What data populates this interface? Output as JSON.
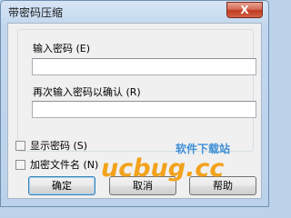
{
  "window": {
    "title": "带密码压缩",
    "close_glyph": "X"
  },
  "password": {
    "label": "输入密码 (E)",
    "value": ""
  },
  "confirm": {
    "label": "再次输入密码以确认 (R)",
    "value": ""
  },
  "show_password": {
    "label": "显示密码 (S)",
    "checked": false
  },
  "encrypt_names": {
    "label": "加密文件名 (N)",
    "checked": false
  },
  "buttons": {
    "ok": "确定",
    "cancel": "取消",
    "help": "帮助"
  },
  "watermark": {
    "main": "ucbug.cc",
    "sub": "软件下载站"
  }
}
